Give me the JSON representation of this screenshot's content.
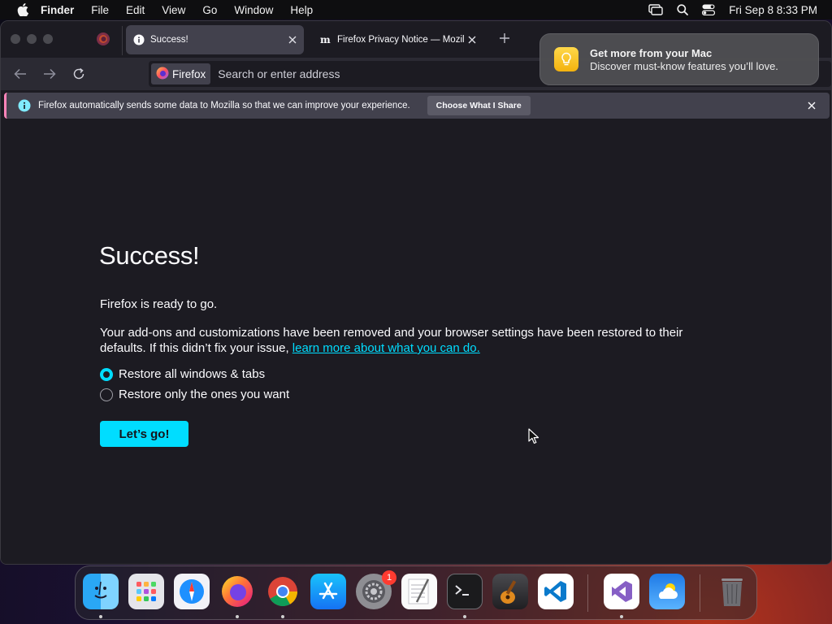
{
  "menubar": {
    "app_name": "Finder",
    "items": [
      "File",
      "Edit",
      "View",
      "Go",
      "Window",
      "Help"
    ],
    "datetime": "Fri Sep 8  8:33 PM"
  },
  "tabs": [
    {
      "title": "Success!",
      "active": true,
      "icon": "info-icon"
    },
    {
      "title": "Firefox Privacy Notice — Mozilla",
      "active": false,
      "icon": "mozilla-m-icon"
    }
  ],
  "urlbar": {
    "identity_label": "Firefox",
    "placeholder": "Search or enter address"
  },
  "infobar": {
    "message": "Firefox automatically sends some data to Mozilla so that we can improve your experience.",
    "button_label": "Choose What I Share"
  },
  "content": {
    "heading": "Success!",
    "ready": "Firefox is ready to go.",
    "description": "Your add-ons and customizations have been removed and your browser settings have been restored to their defaults. If this didn’t fix your issue, ",
    "link_text": "learn more about what you can do.",
    "options": [
      {
        "label": "Restore all windows & tabs",
        "checked": true
      },
      {
        "label": "Restore only the ones you want",
        "checked": false
      }
    ],
    "button_label": "Let’s go!"
  },
  "notification": {
    "title": "Get more from your Mac",
    "body": "Discover must-know features you’ll love."
  },
  "dock": {
    "apps": [
      "Finder",
      "Launchpad",
      "Safari",
      "Firefox",
      "Google Chrome",
      "App Store",
      "System Settings",
      "TextEdit",
      "Terminal",
      "GarageBand",
      "Visual Studio Code",
      "Visual Studio",
      "Weather",
      "Trash"
    ],
    "system_settings_badge": "1"
  },
  "colors": {
    "accent": "#00ddff",
    "window_bg": "#1c1b22",
    "toolbar_bg": "#2b2a33",
    "infobar_bg": "#42414d"
  }
}
